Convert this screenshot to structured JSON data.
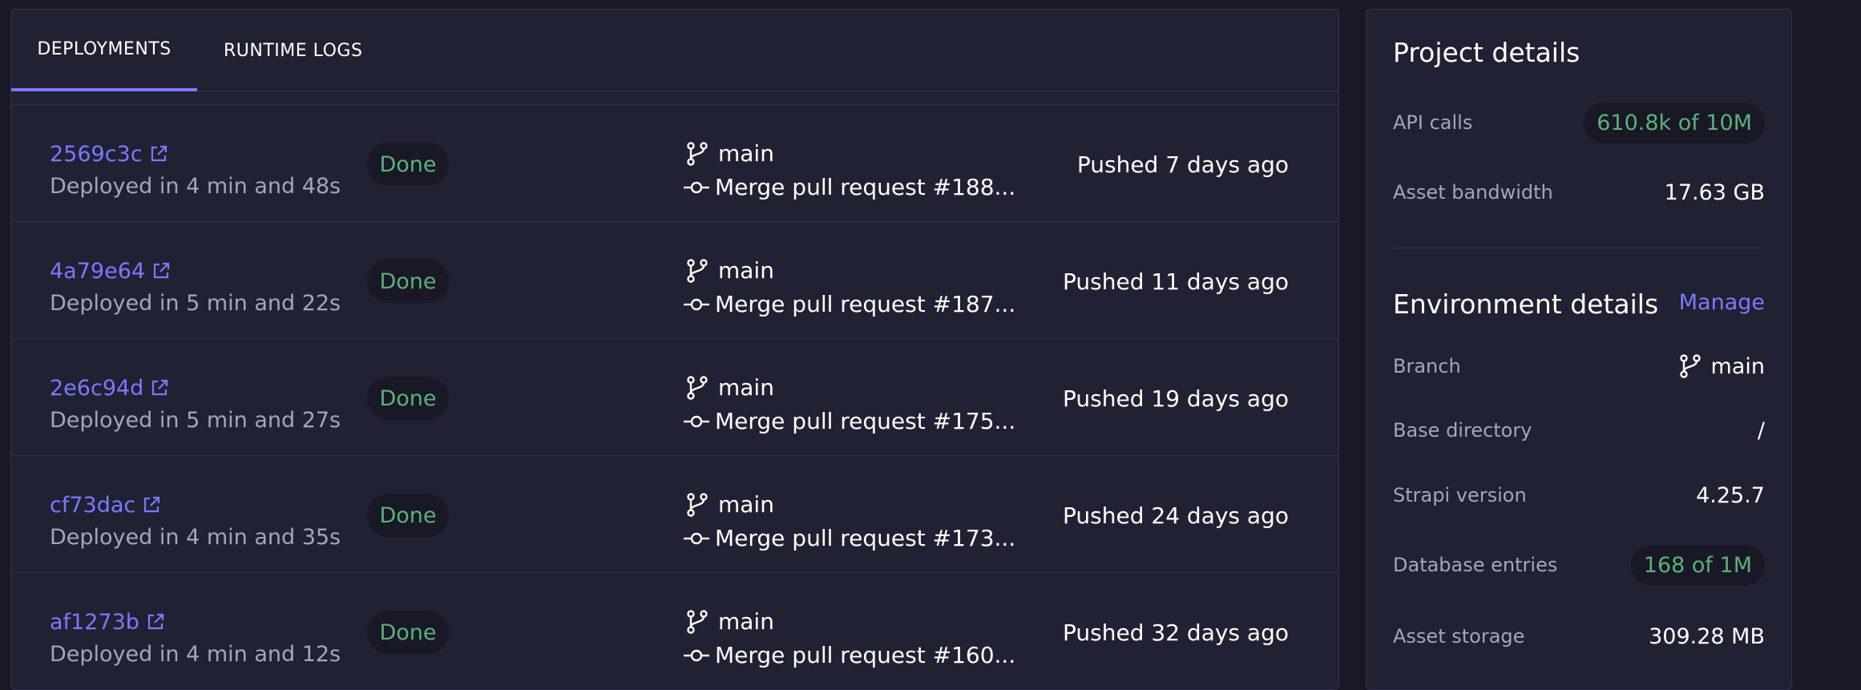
{
  "tabs": [
    {
      "label": "DEPLOYMENTS",
      "active": true
    },
    {
      "label": "RUNTIME LOGS",
      "active": false
    }
  ],
  "deployments": [
    {
      "id": "2569c3c",
      "duration": "Deployed in 4 min and 48s",
      "status": "Done",
      "branch": "main",
      "commit": "Merge pull request #188...",
      "pushed": "Pushed 7 days ago"
    },
    {
      "id": "4a79e64",
      "duration": "Deployed in 5 min and 22s",
      "status": "Done",
      "branch": "main",
      "commit": "Merge pull request #187...",
      "pushed": "Pushed 11 days ago"
    },
    {
      "id": "2e6c94d",
      "duration": "Deployed in 5 min and 27s",
      "status": "Done",
      "branch": "main",
      "commit": "Merge pull request #175...",
      "pushed": "Pushed 19 days ago"
    },
    {
      "id": "cf73dac",
      "duration": "Deployed in 4 min and 35s",
      "status": "Done",
      "branch": "main",
      "commit": "Merge pull request #173...",
      "pushed": "Pushed 24 days ago"
    },
    {
      "id": "af1273b",
      "duration": "Deployed in 4 min and 12s",
      "status": "Done",
      "branch": "main",
      "commit": "Merge pull request #160...",
      "pushed": "Pushed 32 days ago"
    }
  ],
  "project": {
    "title": "Project details",
    "api_calls_label": "API calls",
    "api_calls_value": "610.8k of 10M",
    "bandwidth_label": "Asset bandwidth",
    "bandwidth_value": "17.63 GB"
  },
  "environment": {
    "title": "Environment details",
    "manage_label": "Manage",
    "branch_label": "Branch",
    "branch_value": "main",
    "base_dir_label": "Base directory",
    "base_dir_value": "/",
    "strapi_label": "Strapi version",
    "strapi_value": "4.25.7",
    "db_label": "Database entries",
    "db_value": "168 of 1M",
    "storage_label": "Asset storage",
    "storage_value": "309.28 MB"
  },
  "icons": {
    "external": "external-link-icon",
    "branch": "git-branch-icon",
    "commit": "git-commit-icon"
  },
  "colors": {
    "accent": "#7b79ff",
    "success": "#5cb176",
    "panel": "#212134",
    "background": "#181826"
  }
}
